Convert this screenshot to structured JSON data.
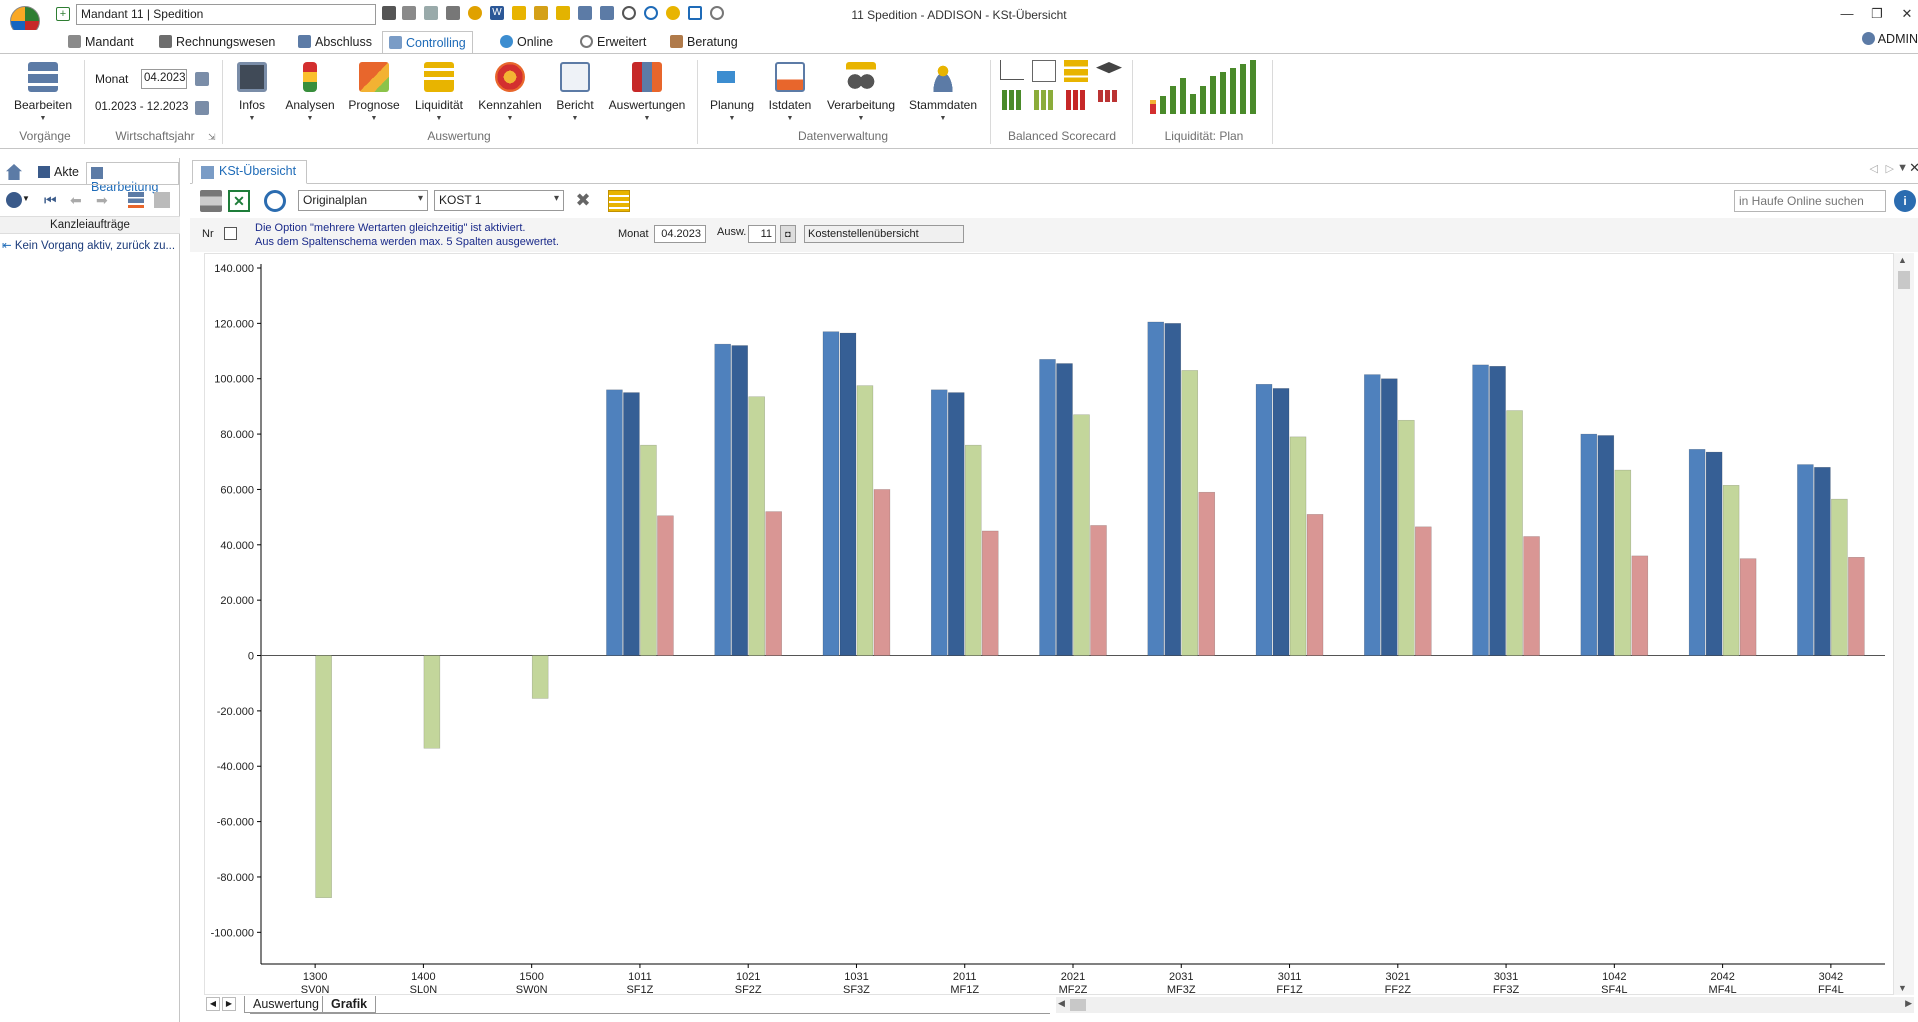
{
  "window": {
    "title": "11 Spedition - ADDISON - KSt-Übersicht",
    "mandant": "Mandant 11   |   Spedition",
    "user": "ADMIN"
  },
  "menu_tabs": [
    "Mandant",
    "Rechnungswesen",
    "Abschluss",
    "Controlling",
    "Online",
    "Erweitert",
    "Beratung"
  ],
  "ribbon": {
    "bearbeiten": "Bearbeiten",
    "vorgaenge": "Vorgänge",
    "monat_label": "Monat",
    "monat_value": "04.2023",
    "range": "01.2023 - 12.2023",
    "wirtschaftsjahr": "Wirtschaftsjahr",
    "auswertung_buttons": [
      "Infos",
      "Analysen",
      "Prognose",
      "Liquidität",
      "Kennzahlen",
      "Bericht",
      "Auswertungen"
    ],
    "auswertung_group": "Auswertung",
    "daten_buttons": [
      "Planung",
      "Istdaten",
      "Verarbeitung",
      "Stammdaten"
    ],
    "daten_group": "Datenverwaltung",
    "bsc_group": "Balanced Scorecard",
    "liq_group": "Liquidität: Plan"
  },
  "left_panel": {
    "tab_akte": "Akte",
    "tab_bearbeitung": "Bearbeitung",
    "header": "Kanzleiaufträge",
    "item": "Kein Vorgang aktiv, zurück zu..."
  },
  "content": {
    "tab": "KSt-Übersicht",
    "plan_select": "Originalplan",
    "kost_select": "KOST 1",
    "search_placeholder": "in Haufe Online suchen",
    "nr_label": "Nr",
    "note1": "Die Option \"mehrere Wertarten gleichzeitig\" ist aktiviert.",
    "note2": "Aus dem Spaltenschema werden max. 5 Spalten ausgewertet.",
    "monat_label": "Monat",
    "monat_value": "04.2023",
    "ausw_label": "Ausw.",
    "ausw_value": "11",
    "schema_value": "Kostenstellenübersicht"
  },
  "bottom_tabs": [
    "Auswertung",
    "Grafik"
  ],
  "chart_data": {
    "type": "bar",
    "categories": [
      "1300\nSV0N",
      "1400\nSL0N",
      "1500\nSW0N",
      "1011\nSF1Z",
      "1021\nSF2Z",
      "1031\nSF3Z",
      "2011\nMF1Z",
      "2021\nMF2Z",
      "2031\nMF3Z",
      "3011\nFF1Z",
      "3021\nFF2Z",
      "3031\nFF3Z",
      "1042\nSF4L",
      "2042\nMF4L",
      "3042\nFF4L"
    ],
    "series": [
      {
        "color": "#4f81bd",
        "values": [
          0,
          0,
          0,
          96000,
          112500,
          117000,
          96000,
          107000,
          120500,
          98000,
          101500,
          105000,
          80000,
          74500,
          69000
        ]
      },
      {
        "color": "#365f95",
        "values": [
          0,
          0,
          0,
          95000,
          112000,
          116500,
          95000,
          105500,
          120000,
          96500,
          100000,
          104500,
          79500,
          73500,
          68000
        ]
      },
      {
        "color": "#c3d69b",
        "values": [
          -87500,
          -33500,
          -15500,
          76000,
          93500,
          97500,
          76000,
          87000,
          103000,
          79000,
          85000,
          88500,
          67000,
          61500,
          56500
        ]
      },
      {
        "color": "#d99694",
        "values": [
          0,
          0,
          0,
          50500,
          52000,
          60000,
          45000,
          47000,
          59000,
          51000,
          46500,
          43000,
          36000,
          35000,
          35500
        ]
      }
    ],
    "ylim": [
      -110000,
      140000
    ],
    "yticks": [
      140000,
      120000,
      100000,
      80000,
      60000,
      40000,
      20000,
      0,
      -20000,
      -40000,
      -60000,
      -80000,
      -100000
    ],
    "ytick_labels": [
      "140.000",
      "120.000",
      "100.000",
      "80.000",
      "60.000",
      "40.000",
      "20.000",
      "0",
      "-20.000",
      "-40.000",
      "-60.000",
      "-80.000",
      "-100.000"
    ],
    "grid": false,
    "legend": "none"
  }
}
